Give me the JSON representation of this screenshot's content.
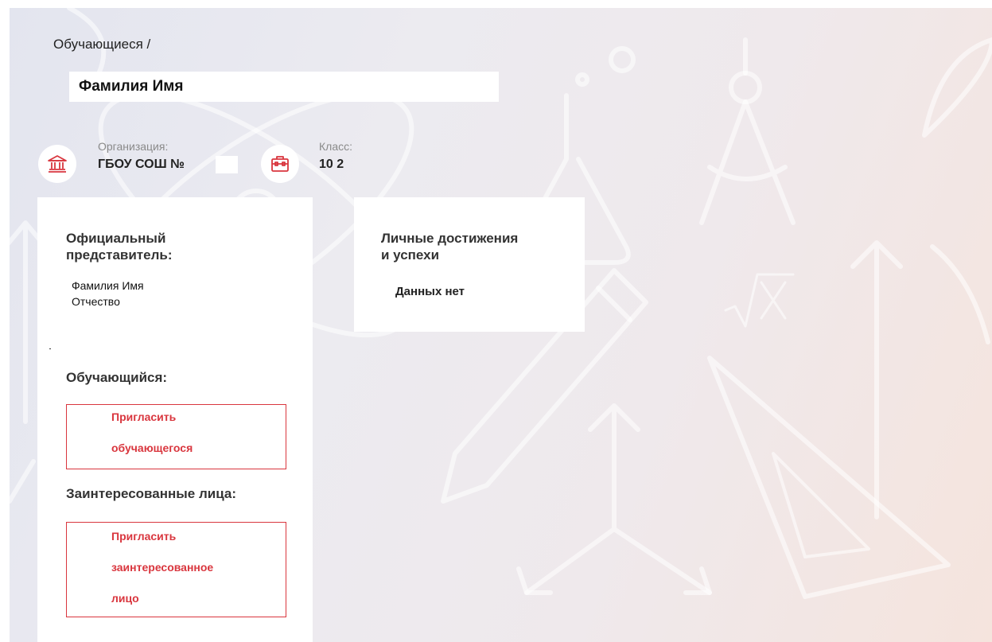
{
  "breadcrumb": {
    "text": "Обучающиеся /"
  },
  "student": {
    "full_name": "Фамилия Имя"
  },
  "info": {
    "organization": {
      "label": "Организация:",
      "value": "ГБОУ СОШ №",
      "icon": "building-icon"
    },
    "class": {
      "label": "Класс:",
      "value": "10 2",
      "icon": "briefcase-icon"
    }
  },
  "left_card": {
    "representative_title_line1": "Официальный",
    "representative_title_line2": "представитель:",
    "representative_name_line1": "Фамилия Имя",
    "representative_name_line2": "Отчество",
    "student_title": "Обучающийся:",
    "invite_student_line1": "Пригласить",
    "invite_student_line2": "обучающегося",
    "interested_title": "Заинтересованные лица:",
    "invite_interested_line1": "Пригласить",
    "invite_interested_line2": "заинтересованное",
    "invite_interested_line3": "лицо"
  },
  "right_card": {
    "title_line1": "Личные достижения",
    "title_line2": "и успехи",
    "empty_text": "Данных нет"
  },
  "colors": {
    "accent": "#d9363e",
    "text": "#333333",
    "muted": "#8a8a8a"
  }
}
